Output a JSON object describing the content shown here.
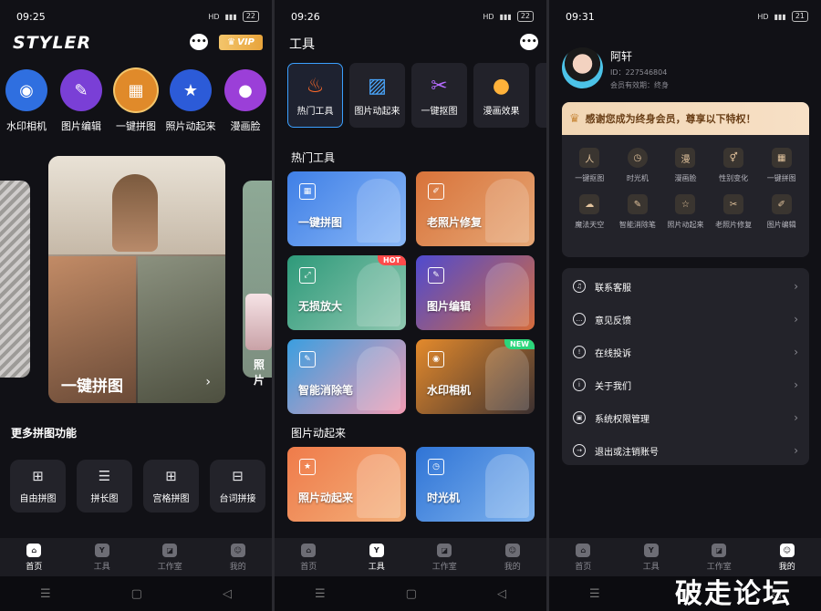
{
  "screen1": {
    "time": "09:25",
    "battery": "22",
    "logo": "STYLER",
    "chat_glyph": "•••",
    "vip_label": "VIP",
    "quick_tools": [
      {
        "label": "水印相机",
        "icon": "camera-icon",
        "color": "#2f6fe0"
      },
      {
        "label": "图片编辑",
        "icon": "edit-icon",
        "color": "#7a3fd6"
      },
      {
        "label": "一键拼图",
        "icon": "puzzle-icon",
        "color": "#e08a2a"
      },
      {
        "label": "照片动起来",
        "icon": "star-icon",
        "color": "#2c5bd8"
      },
      {
        "label": "漫画脸",
        "icon": "bear-icon",
        "color": "#9b3fd8"
      }
    ],
    "carousel": {
      "main_label": "一键拼图",
      "side_label": "照片"
    },
    "more_title": "更多拼图功能",
    "more_tools": [
      {
        "label": "自由拼图",
        "icon": "free-collage-icon"
      },
      {
        "label": "拼长图",
        "icon": "long-image-icon"
      },
      {
        "label": "宫格拼图",
        "icon": "grid-icon"
      },
      {
        "label": "台词拼接",
        "icon": "caption-icon"
      }
    ]
  },
  "screen2": {
    "time": "09:26",
    "battery": "22",
    "title": "工具",
    "chat_glyph": "•••",
    "tabs": [
      {
        "label": "热门工具",
        "icon": "fire-icon",
        "active": true
      },
      {
        "label": "图片动起来",
        "icon": "image-icon",
        "active": false
      },
      {
        "label": "一键抠图",
        "icon": "scissors-icon",
        "active": false
      },
      {
        "label": "漫画效果",
        "icon": "bear-icon",
        "active": false
      },
      {
        "label": "图",
        "icon": "more-icon",
        "active": false
      }
    ],
    "section_hot": "热门工具",
    "hot_cards": [
      {
        "label": "一键拼图",
        "badge": "",
        "gradient": "linear-gradient(135deg,#3f7fe6,#8ab8f7)",
        "icon": "puzzle-icon"
      },
      {
        "label": "老照片修复",
        "badge": "",
        "gradient": "linear-gradient(135deg,#d8733a,#e6a776)",
        "icon": "photo-restore-icon"
      },
      {
        "label": "无损放大",
        "badge": "HOT",
        "gradient": "linear-gradient(135deg,#2e9a7a,#8fc7b0)",
        "icon": "enlarge-icon"
      },
      {
        "label": "图片编辑",
        "badge": "",
        "gradient": "linear-gradient(135deg,#4f4ad0,#d56b3b)",
        "icon": "edit-icon"
      },
      {
        "label": "智能消除笔",
        "badge": "",
        "gradient": "linear-gradient(135deg,#3a9ee0,#f29bb3)",
        "icon": "brush-icon"
      },
      {
        "label": "水印相机",
        "badge": "NEW",
        "gradient": "linear-gradient(135deg,#e48a2c,#3b3030)",
        "icon": "camera-icon"
      }
    ],
    "section_anim": "图片动起来",
    "anim_cards": [
      {
        "label": "照片动起来",
        "gradient": "linear-gradient(135deg,#ef7b4a,#f3b07a)",
        "icon": "star-icon"
      },
      {
        "label": "时光机",
        "gradient": "linear-gradient(135deg,#2f74d6,#7fb3ee)",
        "icon": "clock-icon"
      }
    ]
  },
  "screen3": {
    "time": "09:31",
    "battery": "21",
    "user": {
      "name": "阿轩",
      "id": "ID：227546804",
      "expiry": "会员有效期：终身"
    },
    "member_banner": "感谢您成为终身会员，尊享以下特权！",
    "privileges": [
      {
        "label": "一键抠图",
        "icon": "portrait-icon",
        "glyph": "人"
      },
      {
        "label": "时光机",
        "icon": "clock-icon",
        "glyph": "◷"
      },
      {
        "label": "漫画脸",
        "icon": "comic-icon",
        "glyph": "漫"
      },
      {
        "label": "性别变化",
        "icon": "gender-icon",
        "glyph": "⚥"
      },
      {
        "label": "一键拼图",
        "icon": "puzzle-icon",
        "glyph": "▦"
      },
      {
        "label": "魔法天空",
        "icon": "cloud-icon",
        "glyph": "☁"
      },
      {
        "label": "智能消除笔",
        "icon": "brush-icon",
        "glyph": "✎"
      },
      {
        "label": "照片动起来",
        "icon": "star-icon",
        "glyph": "☆"
      },
      {
        "label": "老照片修复",
        "icon": "wrench-icon",
        "glyph": "✂"
      },
      {
        "label": "图片编辑",
        "icon": "edit-icon",
        "glyph": "✐"
      }
    ],
    "menu": [
      {
        "label": "联系客服",
        "icon": "headset-icon",
        "glyph": "♫"
      },
      {
        "label": "意见反馈",
        "icon": "feedback-icon",
        "glyph": "…"
      },
      {
        "label": "在线投诉",
        "icon": "alarm-icon",
        "glyph": "!"
      },
      {
        "label": "关于我们",
        "icon": "info-icon",
        "glyph": "i"
      },
      {
        "label": "系统权限管理",
        "icon": "lock-icon",
        "glyph": "▣"
      },
      {
        "label": "退出或注销账号",
        "icon": "logout-icon",
        "glyph": "→"
      }
    ]
  },
  "bottom_nav": {
    "home": "首页",
    "tools": "工具",
    "studio": "工作室",
    "mine": "我的"
  },
  "watermark": "破走论坛"
}
